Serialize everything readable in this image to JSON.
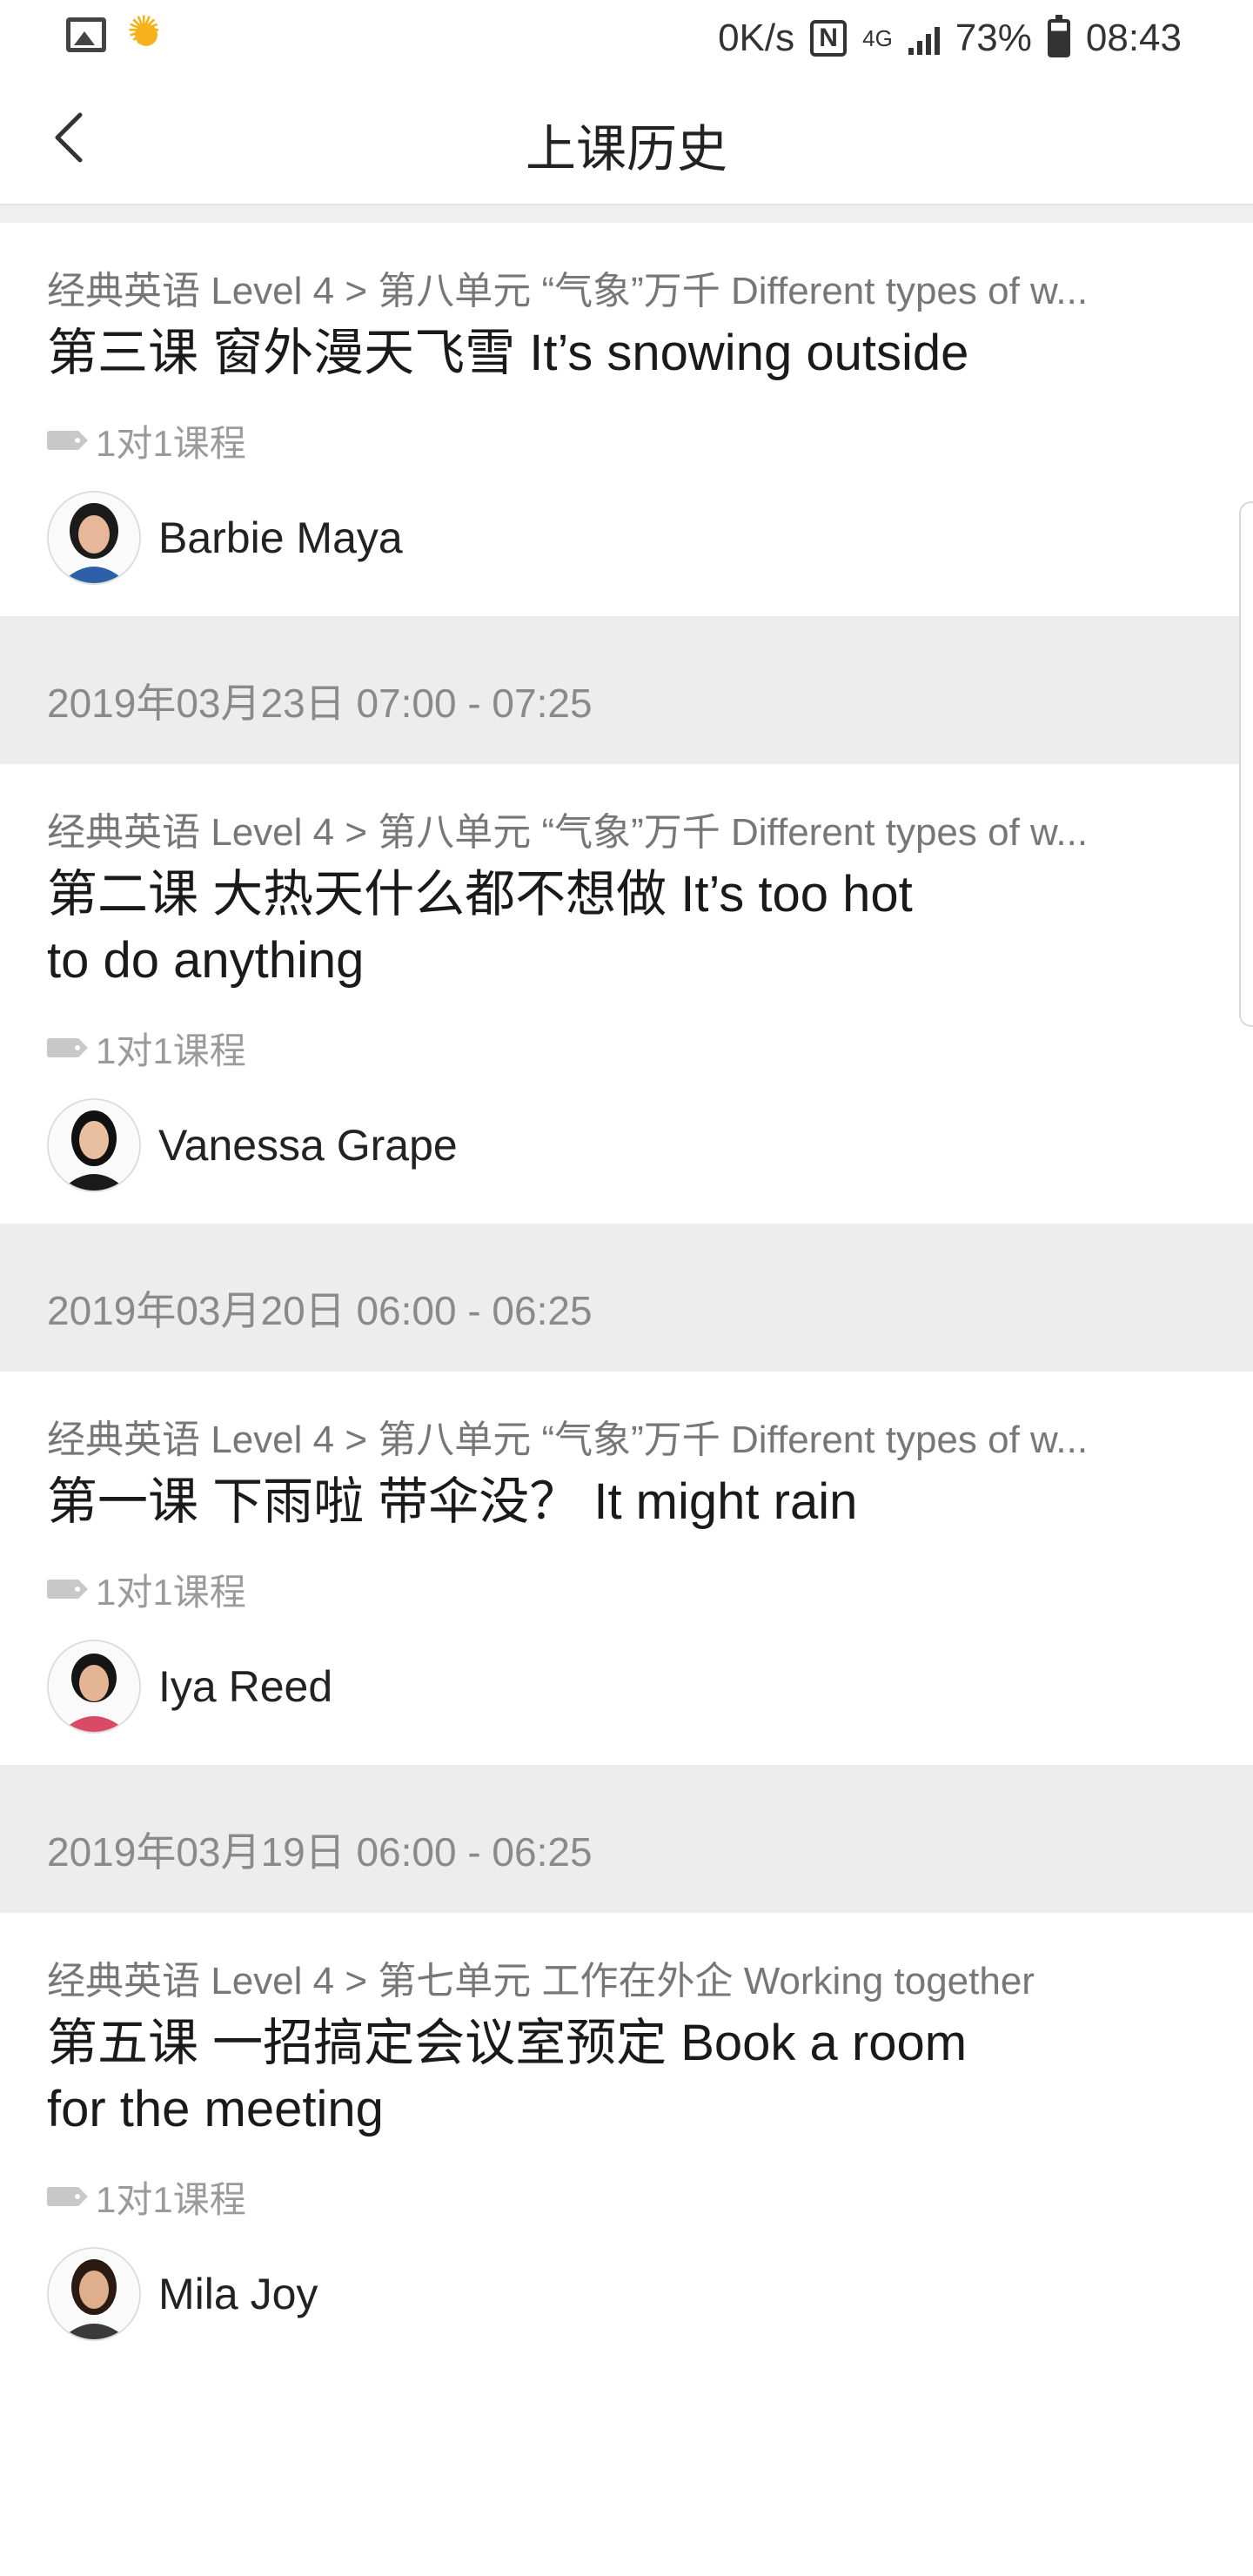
{
  "status_bar": {
    "net_speed": "0K/s",
    "network_label": "4G",
    "battery": "73%",
    "time": "08:43"
  },
  "nav": {
    "title": "上课历史"
  },
  "lessons": [
    {
      "course_path": "经典英语 Level 4 > 第八单元 “气象”万千 Different types of w...",
      "title_line1": "第三课 窗外漫天飞雪 It’s snowing outside",
      "title_line2": "",
      "tag": "1对1课程",
      "teacher": "Barbie Maya",
      "avatar_shirt": "#2c5fa8"
    },
    {
      "date": "2019年03月23日 07:00 - 07:25",
      "course_path": "经典英语 Level 4 > 第八单元 “气象”万千 Different types of w...",
      "title_line1": "第二课 大热天什么都不想做 It’s too hot",
      "title_line2": "to do anything",
      "tag": "1对1课程",
      "teacher": "Vanessa Grape",
      "avatar_shirt": "#1a1a1a"
    },
    {
      "date": "2019年03月20日 06:00 - 06:25",
      "course_path": "经典英语 Level 4 > 第八单元 “气象”万千 Different types of w...",
      "title_line1": "第一课 下雨啦 带伞没？ It might rain",
      "title_line2": "",
      "tag": "1对1课程",
      "teacher": "Iya Reed",
      "avatar_shirt": "#d94a66"
    },
    {
      "date": "2019年03月19日 06:00 - 06:25",
      "course_path": "经典英语 Level 4 > 第七单元 工作在外企 Working together",
      "title_line1": "第五课 一招搞定会议室预定 Book a room",
      "title_line2": "for the meeting",
      "tag": "1对1课程",
      "teacher": "Mila Joy",
      "avatar_shirt": "#3a3a3a"
    }
  ]
}
